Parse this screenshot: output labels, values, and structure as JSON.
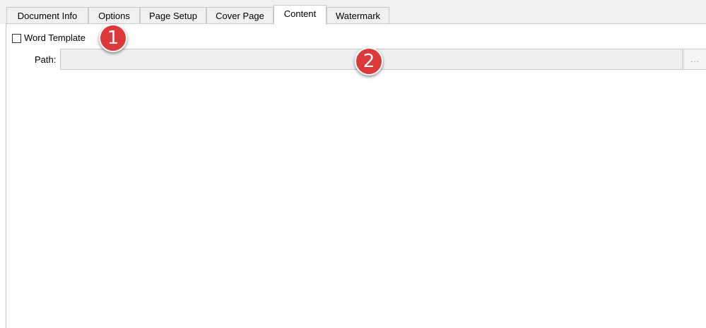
{
  "tabs": [
    {
      "label": "Document Info",
      "active": false
    },
    {
      "label": "Options",
      "active": false
    },
    {
      "label": "Page Setup",
      "active": false
    },
    {
      "label": "Cover Page",
      "active": false
    },
    {
      "label": "Content",
      "active": true
    },
    {
      "label": "Watermark",
      "active": false
    }
  ],
  "content": {
    "word_template_label": "Word Template",
    "word_template_checked": false,
    "path_label": "Path:",
    "path_value": "",
    "browse_label": "..."
  },
  "annotations": [
    {
      "number": "1",
      "color": "#dc3a3a"
    },
    {
      "number": "2",
      "color": "#dc3a3a"
    }
  ]
}
